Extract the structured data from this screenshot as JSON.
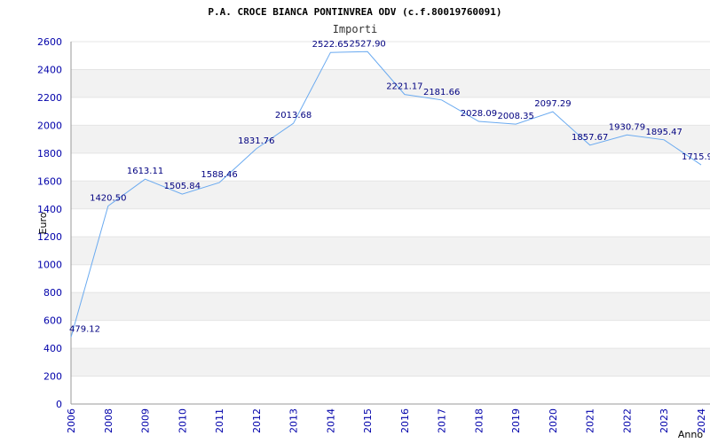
{
  "chart_data": {
    "type": "line",
    "title": "P.A. CROCE BIANCA PONTINVREA ODV (c.f.80019760091)",
    "subtitle": "Importi",
    "xlabel": "Anno",
    "ylabel": "Euro",
    "categories": [
      "2006",
      "2008",
      "2009",
      "2010",
      "2011",
      "2012",
      "2013",
      "2014",
      "2015",
      "2016",
      "2017",
      "2018",
      "2019",
      "2020",
      "2021",
      "2022",
      "2023",
      "2024"
    ],
    "series": [
      {
        "values": [
          479.12,
          1420.5,
          1613.11,
          1505.84,
          1588.46,
          1831.76,
          2013.68,
          2522.65,
          2527.9,
          2221.17,
          2181.66,
          2028.09,
          2008.35,
          2097.29,
          1857.67,
          1930.79,
          1895.47,
          1715.9
        ]
      }
    ],
    "value_labels": [
      "479.12",
      "1420.50",
      "1613.11",
      "1505.84",
      "1588.46",
      "1831.76",
      "2013.68",
      "2522.65",
      "2527.90",
      "2221.17",
      "2181.66",
      "2028.09",
      "2008.35",
      "2097.29",
      "1857.67",
      "1930.79",
      "1895.47",
      "1715.9"
    ],
    "y_ticks": [
      0,
      200,
      400,
      600,
      800,
      1000,
      1200,
      1400,
      1600,
      1800,
      2000,
      2200,
      2400,
      2600
    ],
    "ylim": [
      0,
      2600
    ],
    "grid": true,
    "colors": {
      "line": "#6aaaf0",
      "band": "#f2f2f2",
      "tick_text": "#0000aa",
      "label_text": "#000080"
    }
  }
}
